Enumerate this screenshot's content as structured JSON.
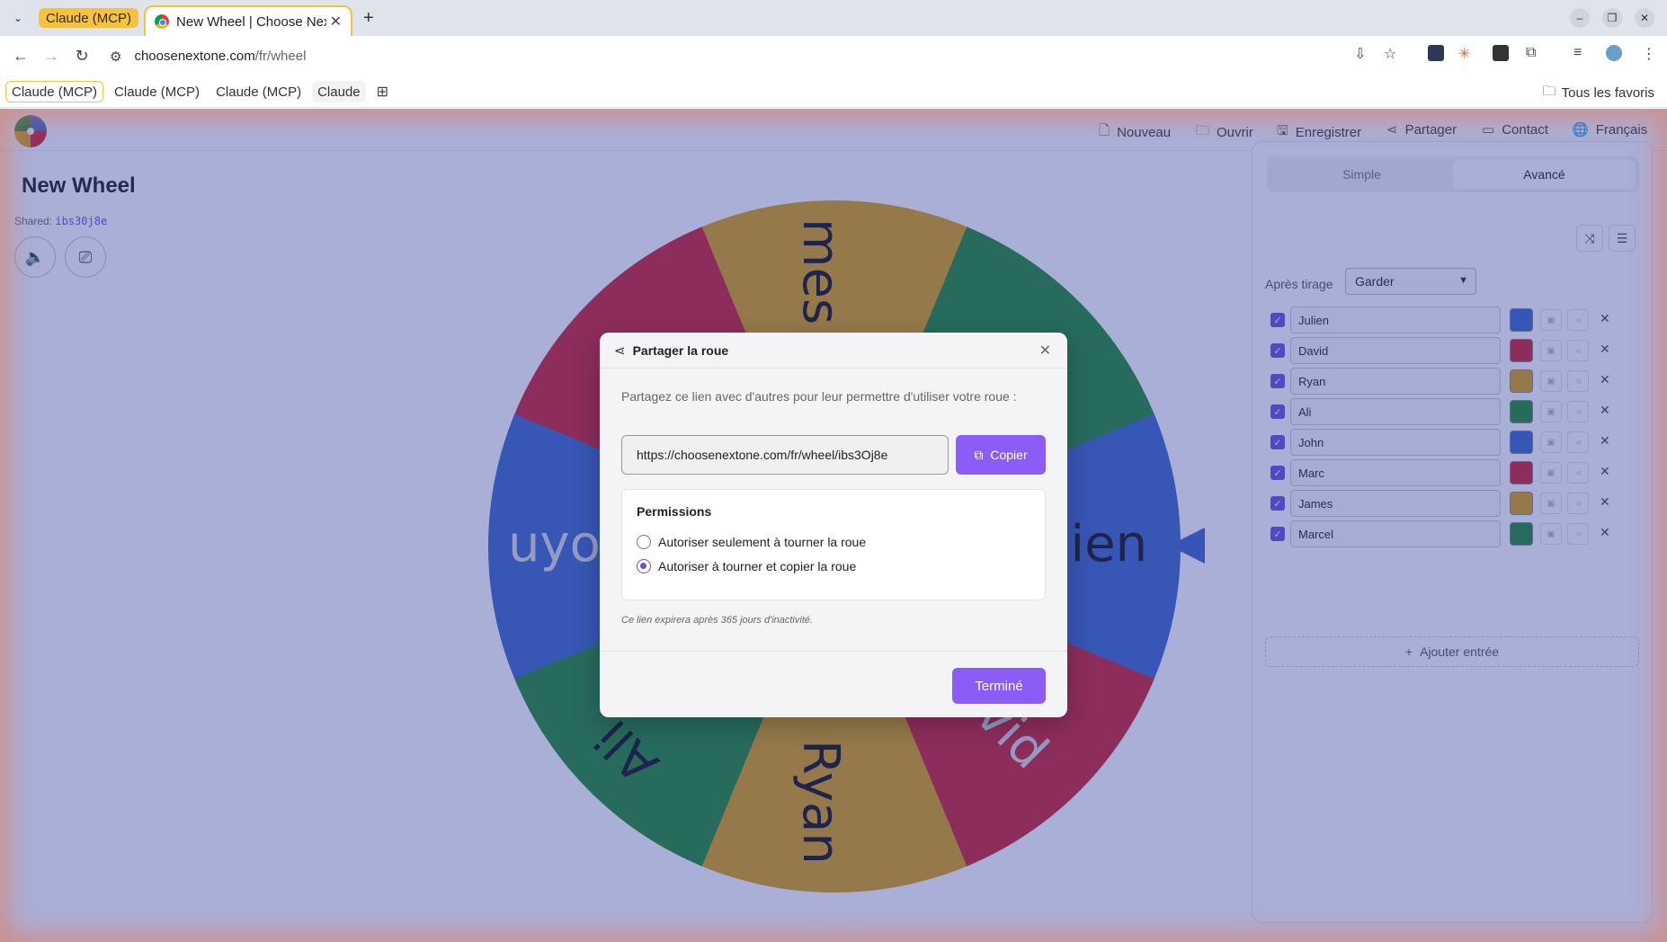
{
  "browser": {
    "tab_group_label": "Claude (MCP)",
    "active_tab_title": "New Wheel | Choose Next",
    "url_host": "choosenextone.com",
    "url_path": "/fr/wheel",
    "bookmarks": [
      "Claude (MCP)",
      "Claude (MCP)",
      "Claude (MCP)",
      "Claude"
    ],
    "bookmarks_right": "Tous les favoris"
  },
  "nav": {
    "items": [
      "Nouveau",
      "Ouvrir",
      "Enregistrer",
      "Partager",
      "Contact",
      "Français"
    ]
  },
  "wheel": {
    "title": "New Wheel",
    "shared_label": "Shared:",
    "shared_code": "ibs30j8e",
    "segments": [
      "James",
      "Marcel",
      "Julien",
      "David",
      "Ryan",
      "Ali",
      "John",
      "Marc"
    ],
    "visible_labels": {
      "top": "mes",
      "right": "lien",
      "bottom": "Ryan",
      "left": "uyo",
      "lower_left": "Ali",
      "lower_right": "vid"
    }
  },
  "panel": {
    "mode_simple": "Simple",
    "mode_advanced": "Avancé",
    "after_draw_label": "Après tirage",
    "after_draw_value": "Garder",
    "entries": [
      {
        "name": "Julien",
        "color": "#3a64c6"
      },
      {
        "name": "David",
        "color": "#cf1f2b"
      },
      {
        "name": "Ryan",
        "color": "#dca30f"
      },
      {
        "name": "Ali",
        "color": "#1f8a2e"
      },
      {
        "name": "John",
        "color": "#3a64c6"
      },
      {
        "name": "Marc",
        "color": "#cf1f2b"
      },
      {
        "name": "James",
        "color": "#dca30f"
      },
      {
        "name": "Marcel",
        "color": "#1f8a2e"
      }
    ],
    "add_entry": "Ajouter entrée"
  },
  "modal": {
    "title": "Partager la roue",
    "description": "Partagez ce lien avec d'autres pour leur permettre d'utiliser votre roue :",
    "link": "https://choosenextone.com/fr/wheel/ibs3Oj8e",
    "copy_label": "Copier",
    "permissions_title": "Permissions",
    "option_spin_only": "Autoriser seulement à tourner la roue",
    "option_spin_copy": "Autoriser à tourner et copier la roue",
    "selected_option": "option_spin_copy",
    "expire_note": "Ce lien expirera après 365 jours d'inactivité.",
    "done_label": "Terminé"
  },
  "colors": {
    "accent": "#8b5cf6",
    "checkbox": "#6a4fd8",
    "overlay": "rgba(50,65,160,0.42)"
  }
}
